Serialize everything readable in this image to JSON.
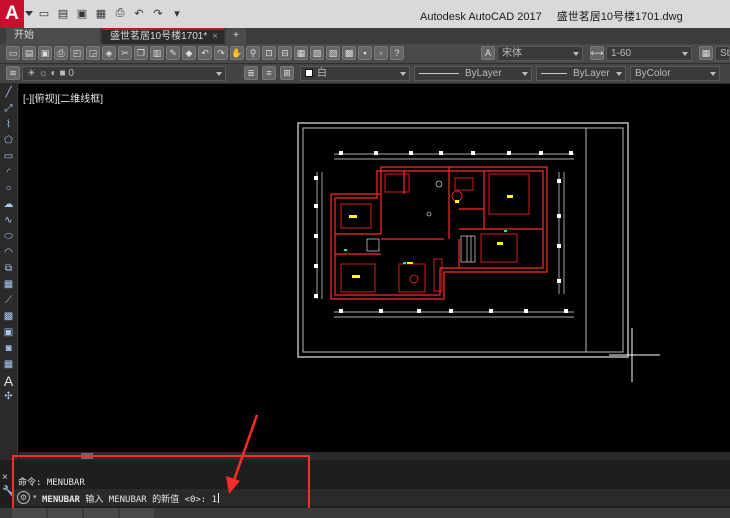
{
  "window": {
    "app_name": "Autodesk AutoCAD 2017",
    "file_name": "盛世茗居10号楼1701.dwg"
  },
  "app_logo": "A",
  "tabs": [
    {
      "label": "开始"
    },
    {
      "label": "盛世茗居10号楼1701*",
      "active": true
    }
  ],
  "toolbar": {
    "text_style": "宋体",
    "dim_style": "1-60",
    "table_style": "Sta"
  },
  "layers_bar": {
    "current_layer": "0",
    "color": "白",
    "linetype": "ByLayer",
    "lineweight": "ByLayer",
    "plot_style": "ByColor"
  },
  "viewport": {
    "label": "[-][俯视][二维线框]"
  },
  "drawing": {
    "background": "#000000",
    "border_color": "#c8c8c8",
    "wall_color": "#ff2a2a",
    "dim_color": "#e6e6e6",
    "highlight_color": "#ffff00"
  },
  "command_line": {
    "history": "命令: MENUBAR",
    "prompt_command": "MENUBAR",
    "prompt_rest": " 输入 MENUBAR 的新值 <0>: ",
    "input_value": "1"
  },
  "annotation": {
    "color": "#ff2a2a"
  },
  "icons": {
    "close": "close-icon",
    "settings": "wrench-icon",
    "command": "command-icon"
  }
}
